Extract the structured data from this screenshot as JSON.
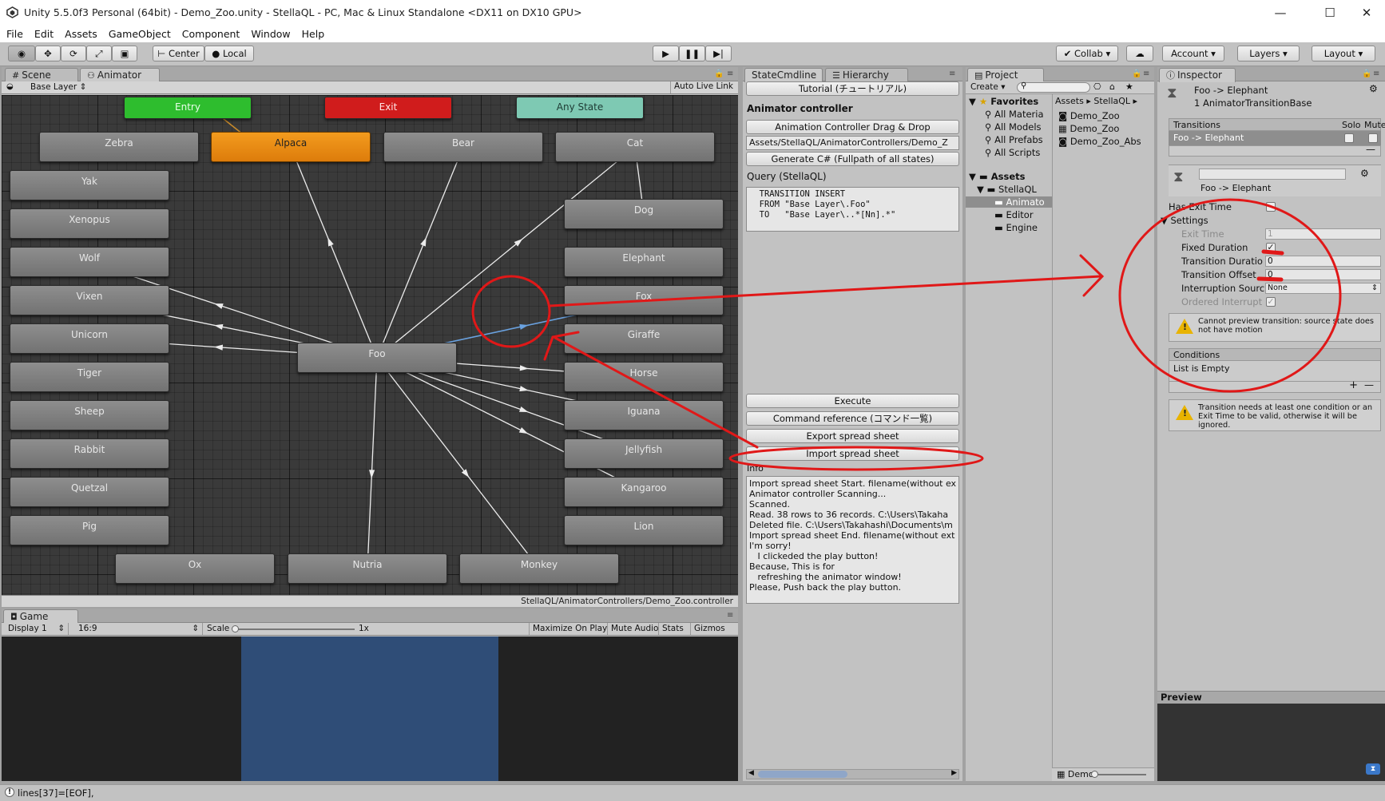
{
  "window": {
    "title": "Unity 5.5.0f3 Personal (64bit) - Demo_Zoo.unity - StellaQL - PC, Mac & Linux Standalone <DX11 on DX10 GPU>",
    "minimize_glyph": "—",
    "maximize_glyph": "☐",
    "close_glyph": "✕"
  },
  "menu": [
    "File",
    "Edit",
    "Assets",
    "GameObject",
    "Component",
    "Window",
    "Help"
  ],
  "toolbar": {
    "pivot": "Center",
    "space": "Local",
    "collab": "Collab",
    "account": "Account",
    "layers": "Layers",
    "layout": "Layout"
  },
  "tabs": {
    "scene": "Scene",
    "animator": "Animator",
    "game": "Game",
    "statecmd": "StateCmdline",
    "hierarchy": "Hierarchy",
    "project": "Project",
    "inspector": "Inspector"
  },
  "animator": {
    "layer": "Base Layer",
    "auto_live_link": "Auto Live Link",
    "footer_path": "StellaQL/AnimatorControllers/Demo_Zoo.controller",
    "special_nodes": {
      "entry": "Entry",
      "exit": "Exit",
      "any": "Any State"
    },
    "nodes": [
      "Zebra",
      "Alpaca",
      "Bear",
      "Cat",
      "Yak",
      "Dog",
      "Xenopus",
      "Wolf",
      "Elephant",
      "Vixen",
      "Fox",
      "Unicorn",
      "Giraffe",
      "Foo",
      "Tiger",
      "Horse",
      "Sheep",
      "Iguana",
      "Rabbit",
      "Jellyfish",
      "Quetzal",
      "Kangaroo",
      "Pig",
      "Lion",
      "Ox",
      "Nutria",
      "Monkey"
    ]
  },
  "game": {
    "display": "Display 1",
    "aspect": "16:9",
    "scale_label": "Scale",
    "scale_value": "1x",
    "maximize": "Maximize On Play",
    "mute": "Mute Audio",
    "stats": "Stats",
    "gizmos": "Gizmos"
  },
  "cmdline": {
    "tutorial": "Tutorial (チュートリアル)",
    "controller_heading": "Animator controller",
    "drag_drop": "Animation Controller Drag & Drop",
    "controller_path": "Assets/StellaQL/AnimatorControllers/Demo_Z",
    "generate": "Generate C# (Fullpath of all states)",
    "query_label": "Query (StellaQL)",
    "query_text": "  TRANSITION INSERT\n  FROM \"Base Layer\\.Foo\"\n  TO   \"Base Layer\\..*[Nn].*\"",
    "execute": "Execute",
    "command_ref": "Command reference (コマンド一覧)",
    "export": "Export spread sheet",
    "import": "Import spread sheet",
    "info_label": "Info",
    "info_text": "Import spread sheet Start. filename(without ex\nAnimator controller Scanning...\nScanned.\nRead. 38 rows to 36 records. C:\\Users\\Takaha\nDeleted file. C:\\Users\\Takahashi\\Documents\\m\nImport spread sheet End. filename(without ext\nI'm sorry!\n   I clickeded the play button!\nBecause, This is for\n   refreshing the animator window!\nPlease, Push back the play button."
  },
  "project": {
    "create": "Create",
    "favorites": "Favorites",
    "fav_items": [
      "All Materia",
      "All Models",
      "All Prefabs",
      "All Scripts"
    ],
    "assets": "Assets",
    "tree": [
      "StellaQL",
      "Animato",
      "Editor",
      "Engine"
    ],
    "breadcrumb_assets": "Assets",
    "breadcrumb_stellaql": "StellaQL",
    "files": [
      "Demo_Zoo",
      "Demo_Zoo",
      "Demo_Zoo_Abs"
    ],
    "footer_file": "Demo"
  },
  "inspector": {
    "title": "Foo -> Elephant",
    "subtitle": "1 AnimatorTransitionBase",
    "transitions_label": "Transitions",
    "solo": "Solo",
    "mute": "Mute",
    "transition_item": "Foo -> Elephant",
    "sub_title": "Foo -> Elephant",
    "has_exit_time": "Has Exit Time",
    "settings": "Settings",
    "exit_time": "Exit Time",
    "exit_time_value": "1",
    "fixed_duration": "Fixed Duration",
    "transition_duration": "Transition Duratio",
    "transition_duration_value": "0",
    "transition_offset": "Transition Offset",
    "transition_offset_value": "0",
    "interruption_source": "Interruption Sourc",
    "interruption_value": "None",
    "ordered_interrupt": "Ordered Interrupt",
    "warn1": "Cannot preview transition: source state does not have motion",
    "conditions": "Conditions",
    "list_empty": "List is Empty",
    "warn2": "Transition needs at least one condition or an Exit Time to be valid, otherwise it will be ignored.",
    "preview": "Preview"
  },
  "status": {
    "text": "lines[37]=[EOF],"
  },
  "colors": {
    "entry": "#2ebd2e",
    "exit": "#d01c1c",
    "any_state": "#7ec9b3",
    "selected_state": "#f39b1e",
    "annotation": "#e01818",
    "selected_transition": "#4f8fd6"
  }
}
